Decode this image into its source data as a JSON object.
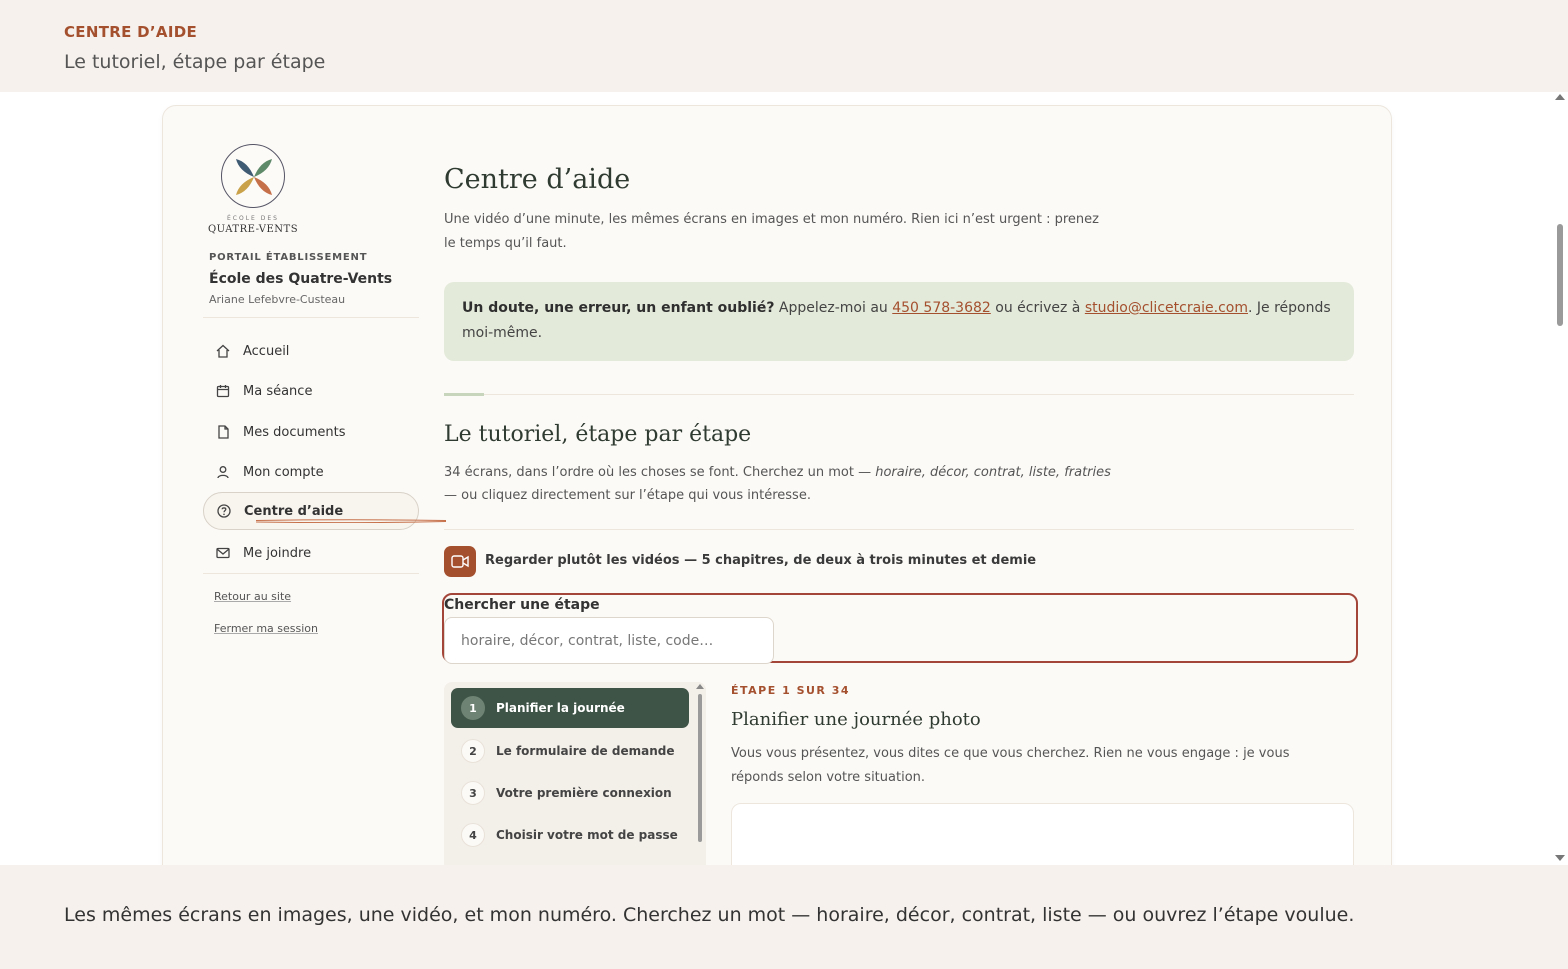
{
  "header": {
    "kicker": "CENTRE D’AIDE",
    "subtitle": "Le tutoriel, étape par étape"
  },
  "sidebar": {
    "logo_small": "ÉCOLE DES",
    "logo_name": "QUATRE-VENTS",
    "portal_label": "PORTAIL ÉTABLISSEMENT",
    "school_name": "École des Quatre-Vents",
    "user_name": "Ariane Lefebvre-Custeau",
    "items": [
      {
        "label": "Accueil",
        "icon": "home-icon"
      },
      {
        "label": "Ma séance",
        "icon": "calendar-icon"
      },
      {
        "label": "Mes documents",
        "icon": "document-icon"
      },
      {
        "label": "Mon compte",
        "icon": "user-icon"
      },
      {
        "label": "Centre d’aide",
        "icon": "help-icon",
        "active": true
      },
      {
        "label": "Me joindre",
        "icon": "mail-icon"
      }
    ],
    "back_link": "Retour au site",
    "logout_link": "Fermer ma session"
  },
  "main": {
    "title": "Centre d’aide",
    "intro": "Une vidéo d’une minute, les mêmes écrans en images et mon numéro. Rien ici n’est urgent : prenez le temps qu’il faut.",
    "callout": {
      "lead": "Un doute, une erreur, un enfant oublié?",
      "text1": " Appelez-moi au ",
      "phone": "450 578-3682",
      "text2": " ou écrivez à ",
      "email": "studio@clicetcraie.com",
      "text3": ". Je réponds moi-même."
    },
    "section_title": "Le tutoriel, étape par étape",
    "section_intro_1": "34 écrans, dans l’ordre où les choses se font. Cherchez un mot — ",
    "section_intro_terms": "horaire, décor, contrat, liste, fratries",
    "section_intro_2": " — ou cliquez directement sur l’étape qui vous intéresse.",
    "video_label": "Regarder plutôt les vidéos — 5 chapitres, de deux à trois minutes et demie",
    "search": {
      "label": "Chercher une étape",
      "placeholder": "horaire, décor, contrat, liste, code…"
    },
    "steps": [
      {
        "num": "1",
        "label": "Planifier la journée",
        "active": true
      },
      {
        "num": "2",
        "label": "Le formulaire de demande"
      },
      {
        "num": "3",
        "label": "Votre première connexion"
      },
      {
        "num": "4",
        "label": "Choisir votre mot de passe"
      }
    ],
    "step_detail": {
      "kicker": "ÉTAPE 1 SUR 34",
      "title": "Planifier une journée photo",
      "desc": "Vous vous présentez, vous dites ce que vous cherchez. Rien ne vous engage : je vous réponds selon votre situation."
    }
  },
  "footer": {
    "text": "Les mêmes écrans en images, une vidéo, et mon numéro. Cherchez un mot — horaire, décor, contrat, liste — ou ouvrez l’étape voulue."
  },
  "colors": {
    "accent": "#a4502f",
    "active_step": "#3e5446",
    "callout_bg": "#e3ead9",
    "band_bg": "#f6f1ec"
  }
}
